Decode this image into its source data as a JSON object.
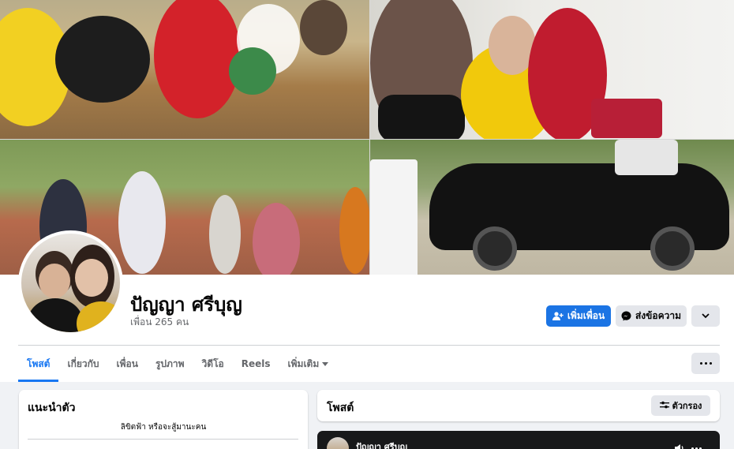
{
  "profile": {
    "name": "ปัญญา ศรีบุญ",
    "friend_count": "เพื่อน 265 คน"
  },
  "actions": {
    "add_friend": "เพิ่มเพื่อน",
    "message": "ส่งข้อความ"
  },
  "tabs": [
    {
      "label": "โพสต์",
      "active": true
    },
    {
      "label": "เกี่ยวกับ"
    },
    {
      "label": "เพื่อน"
    },
    {
      "label": "รูปภาพ"
    },
    {
      "label": "วิดีโอ"
    },
    {
      "label": "Reels"
    },
    {
      "label": "เพิ่มเติม"
    }
  ],
  "intro": {
    "title": "แนะนำตัว",
    "bio": "ลิขิตฟ้า หรือจะสู้มานะคน"
  },
  "posts": {
    "title": "โพสต์",
    "filter_label": "ตัวกรอง"
  },
  "video_post": {
    "author": "ปัญญา ศรีบุญ"
  },
  "colors": {
    "accent": "#1877f2",
    "primary_button": "#1b74e4",
    "secondary_button": "#e4e6eb",
    "page_bg": "#f0f2f5"
  },
  "icons": {
    "add_friend": "person-plus-icon",
    "message": "messenger-icon",
    "more": "chevron-down-icon",
    "tab_more": "caret-down-icon",
    "overflow": "ellipsis-icon",
    "filter": "sliders-icon"
  }
}
